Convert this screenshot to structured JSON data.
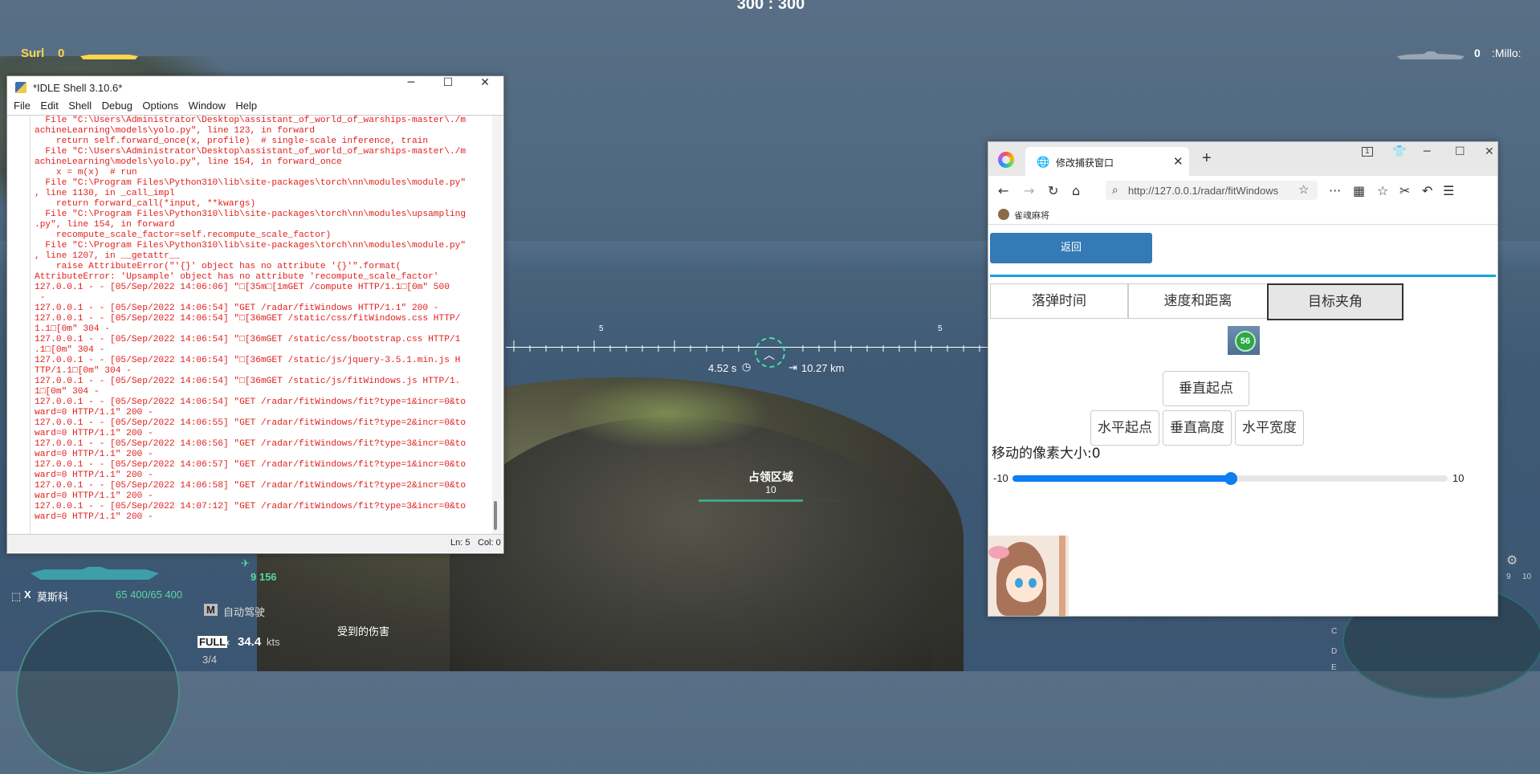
{
  "game": {
    "score": "300 : 300",
    "team_left": {
      "name": "Surl",
      "score": "0"
    },
    "team_right": {
      "name": ":Millo:",
      "score": "0"
    },
    "scale_tick_left": "5",
    "scale_tick_right": "5",
    "time_to_target": "4.52 s",
    "distance": "10.27 km",
    "capture_title": "占领区域",
    "capture_value": "10",
    "ship_tier": "X",
    "ship_name": "莫斯科",
    "hp": "65 400/65 400",
    "damage_stat": "9 156",
    "autopilot": "自动驾驶",
    "autopilot_key": "M",
    "damage_received": "受到的伤害",
    "speed_mode": "FULL",
    "speed": "34.4",
    "speed_unit": "kts",
    "speed_fraction": "3/4",
    "minimap_labels": [
      "9",
      "10",
      "C",
      "D",
      "E"
    ]
  },
  "idle": {
    "title": "*IDLE Shell 3.10.6*",
    "menu": [
      "File",
      "Edit",
      "Shell",
      "Debug",
      "Options",
      "Window",
      "Help"
    ],
    "lines": [
      "  File \"C:\\Users\\Administrator\\Desktop\\assistant_of_world_of_warships-master\\./m",
      "achineLearning\\models\\yolo.py\", line 123, in forward",
      "    return self.forward_once(x, profile)  # single-scale inference, train",
      "  File \"C:\\Users\\Administrator\\Desktop\\assistant_of_world_of_warships-master\\./m",
      "achineLearning\\models\\yolo.py\", line 154, in forward_once",
      "    x = m(x)  # run",
      "  File \"C:\\Program Files\\Python310\\lib\\site-packages\\torch\\nn\\modules\\module.py\"",
      ", line 1130, in _call_impl",
      "    return forward_call(*input, **kwargs)",
      "  File \"C:\\Program Files\\Python310\\lib\\site-packages\\torch\\nn\\modules\\upsampling",
      ".py\", line 154, in forward",
      "    recompute_scale_factor=self.recompute_scale_factor)",
      "  File \"C:\\Program Files\\Python310\\lib\\site-packages\\torch\\nn\\modules\\module.py\"",
      ", line 1207, in __getattr__",
      "    raise AttributeError(\"'{}' object has no attribute '{}'\".format(",
      "AttributeError: 'Upsample' object has no attribute 'recompute_scale_factor'",
      "127.0.0.1 - - [05/Sep/2022 14:06:06] \"□[35m□[1mGET /compute HTTP/1.1□[0m\" 500",
      " -",
      "127.0.0.1 - - [05/Sep/2022 14:06:54] \"GET /radar/fitWindows HTTP/1.1\" 200 -",
      "127.0.0.1 - - [05/Sep/2022 14:06:54] \"□[36mGET /static/css/fitWindows.css HTTP/",
      "1.1□[0m\" 304 -",
      "127.0.0.1 - - [05/Sep/2022 14:06:54] \"□[36mGET /static/css/bootstrap.css HTTP/1",
      ".1□[0m\" 304 -",
      "127.0.0.1 - - [05/Sep/2022 14:06:54] \"□[36mGET /static/js/jquery-3.5.1.min.js H",
      "TTP/1.1□[0m\" 304 -",
      "127.0.0.1 - - [05/Sep/2022 14:06:54] \"□[36mGET /static/js/fitWindows.js HTTP/1.",
      "1□[0m\" 304 -",
      "127.0.0.1 - - [05/Sep/2022 14:06:54] \"GET /radar/fitWindows/fit?type=1&incr=0&to",
      "ward=0 HTTP/1.1\" 200 -",
      "127.0.0.1 - - [05/Sep/2022 14:06:55] \"GET /radar/fitWindows/fit?type=2&incr=0&to",
      "ward=0 HTTP/1.1\" 200 -",
      "127.0.0.1 - - [05/Sep/2022 14:06:56] \"GET /radar/fitWindows/fit?type=3&incr=0&to",
      "ward=0 HTTP/1.1\" 200 -",
      "127.0.0.1 - - [05/Sep/2022 14:06:57] \"GET /radar/fitWindows/fit?type=1&incr=0&to",
      "ward=0 HTTP/1.1\" 200 -",
      "127.0.0.1 - - [05/Sep/2022 14:06:58] \"GET /radar/fitWindows/fit?type=2&incr=0&to",
      "ward=0 HTTP/1.1\" 200 -",
      "127.0.0.1 - - [05/Sep/2022 14:07:12] \"GET /radar/fitWindows/fit?type=3&incr=0&to",
      "ward=0 HTTP/1.1\" 200 -"
    ],
    "status_ln": "Ln: 5",
    "status_col": "Col: 0"
  },
  "browser": {
    "tab_title": "修改捕获窗口",
    "tab_count": "1",
    "url": "http://127.0.0.1/radar/fitWindows",
    "bookmark": "雀魂麻将",
    "page": {
      "back": "返回",
      "tabs": [
        "落弹时间",
        "速度和距离",
        "目标夹角"
      ],
      "active_tab_index": 2,
      "badge": "56",
      "btn_vertical_start": "垂直起点",
      "btn_horizontal_start": "水平起点",
      "btn_vertical_height": "垂直高度",
      "btn_horizontal_width": "水平宽度",
      "move_label": "移动的像素大小:0",
      "range_min": "-10",
      "range_max": "10",
      "range_value": 0
    }
  },
  "colors": {
    "idle_text": "#e0201e",
    "accent_blue": "#337ab7",
    "slider_blue": "#0d7df4",
    "separator": "#17a2e0"
  }
}
